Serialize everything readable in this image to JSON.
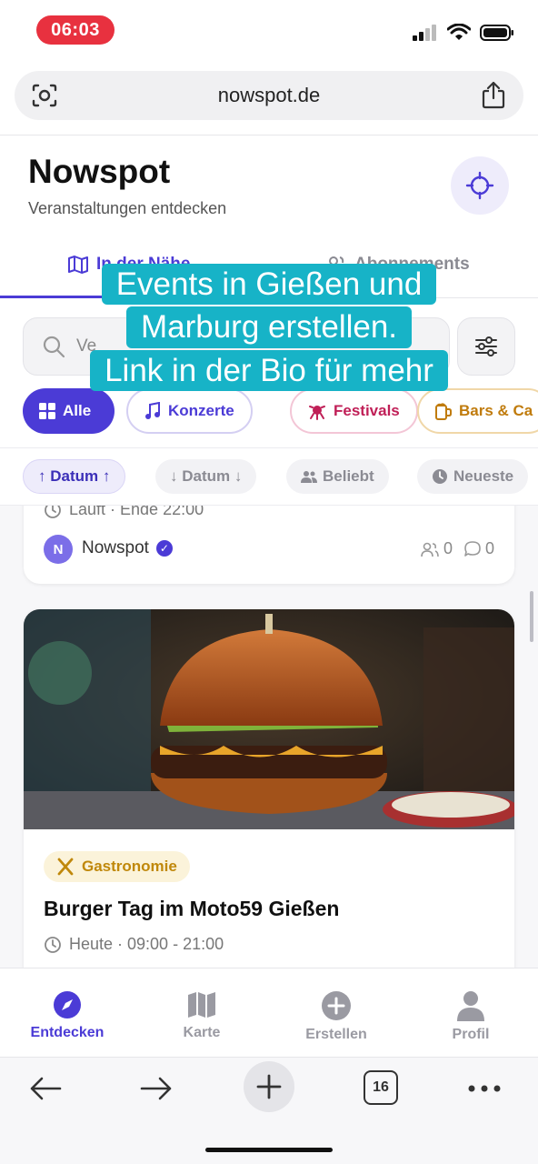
{
  "status_bar": {
    "time": "06:03"
  },
  "browser": {
    "url": "nowspot.de",
    "tab_count": "16"
  },
  "header": {
    "title": "Nowspot",
    "subtitle": "Veranstaltungen entdecken"
  },
  "tabs": [
    {
      "label": "In der Nähe",
      "active": true
    },
    {
      "label": "Abonnements",
      "active": false
    }
  ],
  "search": {
    "value": "Ve"
  },
  "categories": [
    {
      "label": "Alle"
    },
    {
      "label": "Konzerte"
    },
    {
      "label": "Festivals"
    },
    {
      "label": "Bars & Ca"
    }
  ],
  "sorts": [
    {
      "label": "↑ Datum ↑",
      "active": true
    },
    {
      "label": "↓ Datum ↓",
      "active": false
    },
    {
      "label": "Beliebt",
      "active": false
    },
    {
      "label": "Neueste",
      "active": false
    }
  ],
  "prev_card": {
    "time": "Läuft · Ende 22:00",
    "avatar_letter": "N",
    "organizer": "Nowspot",
    "participants": "0",
    "comments": "0"
  },
  "event_card": {
    "category": "Gastronomie",
    "title": "Burger Tag im Moto59 Gießen",
    "time": "Heute · 09:00 - 21:00"
  },
  "overlay": {
    "lines": [
      "Events in Gießen und",
      "Marburg erstellen.",
      "Link in der Bio für mehr"
    ]
  },
  "bottom_nav": [
    {
      "label": "Entdecken",
      "active": true
    },
    {
      "label": "Karte",
      "active": false
    },
    {
      "label": "Erstellen",
      "active": false
    },
    {
      "label": "Profil",
      "active": false
    }
  ],
  "colors": {
    "accent": "#4b3bd6",
    "caption_bg": "#17b3c7",
    "time_pill": "#e8313f",
    "gastro": "#c0880b"
  }
}
